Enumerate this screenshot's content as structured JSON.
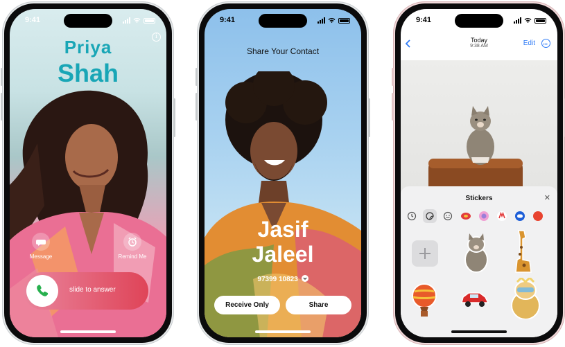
{
  "phone1": {
    "status_time": "9:41",
    "contact_first": "Priya",
    "contact_last": "Shah",
    "info_glyph": "i",
    "action_message": "Message",
    "action_remind": "Remind Me",
    "slide_text": "slide to answer",
    "colors": {
      "name": "#19a6b6",
      "slider_start": "#e9849c",
      "slider_end": "#df4458"
    }
  },
  "phone2": {
    "status_time": "9:41",
    "title": "Share Your Contact",
    "name_first": "Jasif",
    "name_last": "Jaleel",
    "phone_number": "97399 10823",
    "receive_only": "Receive Only",
    "share": "Share"
  },
  "phone3": {
    "status_time": "9:41",
    "nav_title": "Today",
    "nav_time": "9:38 AM",
    "edit": "Edit",
    "sheet_title": "Stickers",
    "close_glyph": "✕",
    "accent": "#2f7bf6",
    "sticker_tabs": [
      "recents-icon",
      "stickers-icon",
      "emoji-sticker-icon",
      "pack-icon-1",
      "pack-icon-2",
      "pack-icon-3",
      "pack-icon-4",
      "pack-icon-5"
    ],
    "stickers": [
      "add-sticker",
      "kitten-sticker",
      "giraffe-sticker",
      "balloon-sticker",
      "red-car-sticker",
      "dog-sticker"
    ]
  }
}
